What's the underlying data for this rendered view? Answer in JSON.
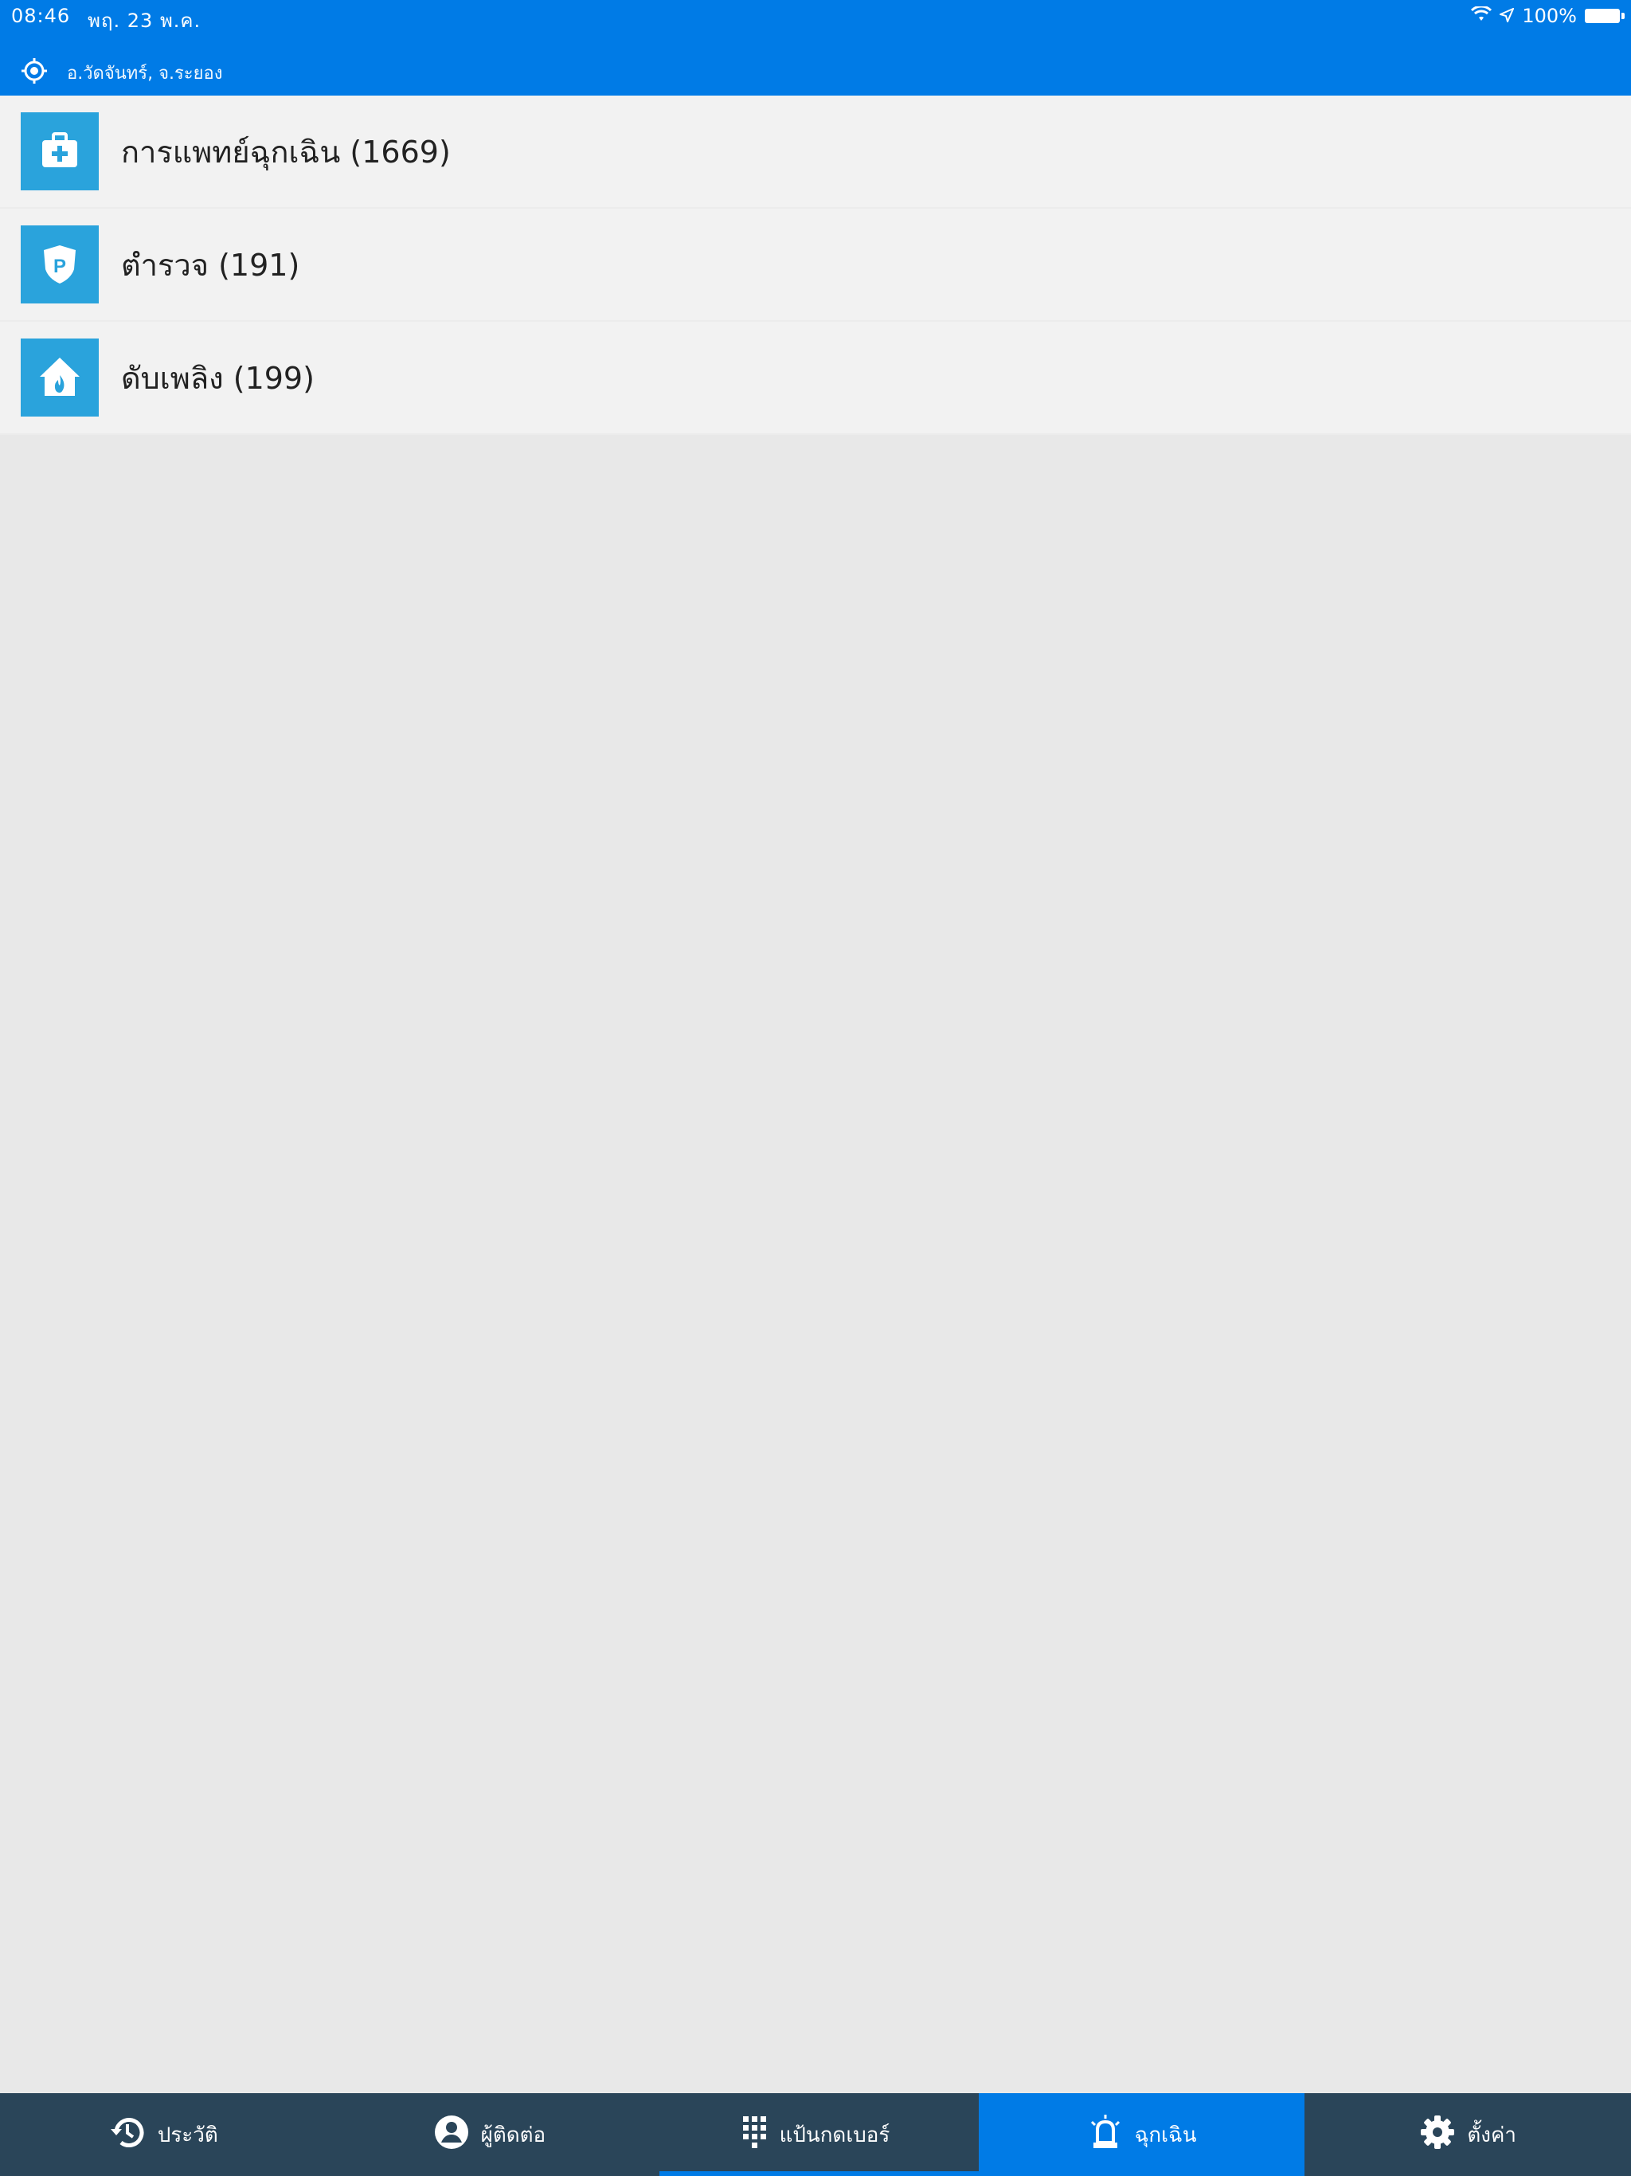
{
  "status_bar": {
    "time": "08:46",
    "date": "พฤ. 23 พ.ค.",
    "battery": "100%"
  },
  "location": {
    "text": "อ.วัดจันทร์, จ.ระยอง"
  },
  "emergency_list": [
    {
      "label": "การแพทย์ฉุกเฉิน (1669)",
      "icon": "medical-kit-icon"
    },
    {
      "label": "ตำรวจ (191)",
      "icon": "police-badge-icon"
    },
    {
      "label": "ดับเพลิง (199)",
      "icon": "fire-house-icon"
    }
  ],
  "tabs": [
    {
      "label": "ประวัติ",
      "icon": "history-icon"
    },
    {
      "label": "ผู้ติดต่อ",
      "icon": "contact-icon"
    },
    {
      "label": "แป้นกดเบอร์",
      "icon": "keypad-icon"
    },
    {
      "label": "ฉุกเฉิน",
      "icon": "siren-icon",
      "active": true
    },
    {
      "label": "ตั้งค่า",
      "icon": "settings-gear-icon"
    }
  ],
  "colors": {
    "header_blue": "#007be6",
    "icon_tile": "#2aa3dc",
    "tabbar": "#2a4559",
    "background": "#e8e8e8"
  }
}
